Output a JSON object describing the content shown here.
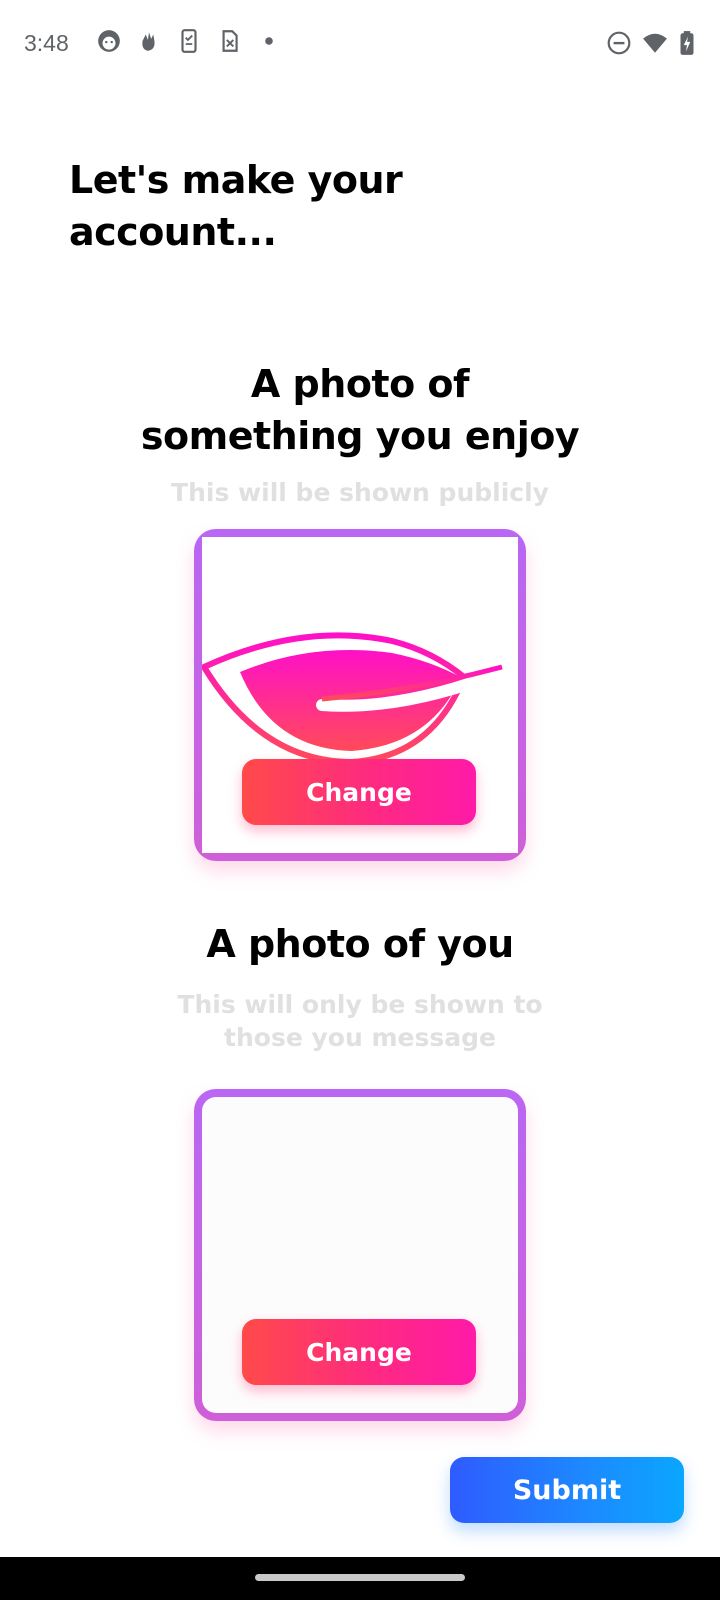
{
  "status_bar": {
    "time": "3:48",
    "left_icons": [
      "face-icon",
      "hand-icon",
      "phone-checklist-icon",
      "sim-x-icon",
      "dot-icon"
    ],
    "right_icons": [
      "do-not-disturb-icon",
      "wifi-icon",
      "battery-charging-icon"
    ]
  },
  "page": {
    "title": "Let's make your account..."
  },
  "public_photo": {
    "title": "A photo of something you enjoy",
    "subtitle": "This will be shown publicly",
    "button_label": "Change",
    "image_icon": "pink-leaf-logo"
  },
  "private_photo": {
    "title": "A photo of you",
    "subtitle": "This will only be shown to those you message",
    "button_label": "Change"
  },
  "actions": {
    "submit_label": "Submit"
  },
  "colors": {
    "card_border": "#b967f4",
    "change_button_start": "#ff4a4a",
    "change_button_end": "#ff1aa8",
    "submit_button_start": "#2f5bff",
    "submit_button_end": "#0aa6ff",
    "subtitle_text": "#e0e0e0"
  }
}
